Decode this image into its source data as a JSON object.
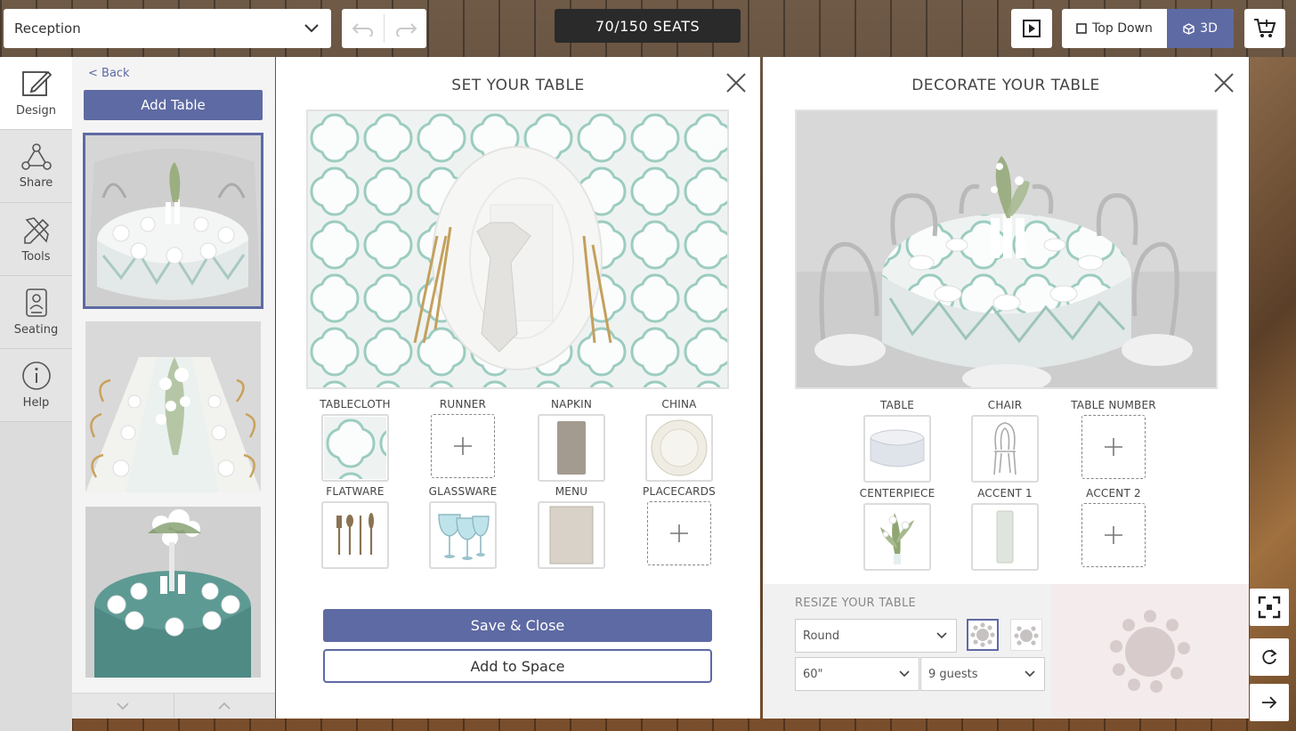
{
  "top_bar": {
    "venue_value": "Reception",
    "seats_text": "70/150 SEATS",
    "view_top_down": "Top Down",
    "view_3d": "3D",
    "active_view": "3D"
  },
  "left_nav": {
    "items": [
      {
        "label": "Design",
        "icon": "pencil-square-icon",
        "active": true
      },
      {
        "label": "Share",
        "icon": "share-nodes-icon",
        "active": false
      },
      {
        "label": "Tools",
        "icon": "tools-icon",
        "active": false
      },
      {
        "label": "Seating",
        "icon": "seating-chart-icon",
        "active": false
      },
      {
        "label": "Help",
        "icon": "info-circle-icon",
        "active": false
      }
    ]
  },
  "thumbs": {
    "back_label": "< Back",
    "add_table_label": "Add Table",
    "items": [
      {
        "kind": "round table with geometric cloth",
        "selected": true
      },
      {
        "kind": "long table with gold chairs",
        "selected": false
      },
      {
        "kind": "round table with teal cloth",
        "selected": false
      }
    ]
  },
  "set_table": {
    "title": "SET YOUR TABLE",
    "slots_row1": [
      {
        "label": "TABLECLOTH",
        "filled": true
      },
      {
        "label": "RUNNER",
        "filled": false
      },
      {
        "label": "NAPKIN",
        "filled": true
      },
      {
        "label": "CHINA",
        "filled": true
      }
    ],
    "slots_row2": [
      {
        "label": "FLATWARE",
        "filled": true
      },
      {
        "label": "GLASSWARE",
        "filled": true
      },
      {
        "label": "MENU",
        "filled": true
      },
      {
        "label": "PLACECARDS",
        "filled": false
      }
    ],
    "save_label": "Save & Close",
    "add_space_label": "Add to Space"
  },
  "decorate_table": {
    "title": "DECORATE YOUR TABLE",
    "slots_row1": [
      {
        "label": "TABLE",
        "filled": true
      },
      {
        "label": "CHAIR",
        "filled": true
      },
      {
        "label": "TABLE NUMBER",
        "filled": false
      }
    ],
    "slots_row2": [
      {
        "label": "CENTERPIECE",
        "filled": true
      },
      {
        "label": "ACCENT 1",
        "filled": true
      },
      {
        "label": "ACCENT 2",
        "filled": false
      }
    ],
    "resize": {
      "title": "RESIZE YOUR TABLE",
      "shape_value": "Round",
      "size_value": "60\"",
      "guests_value": "9 guests"
    }
  },
  "colors": {
    "accent": "#5e6aa3",
    "seat_badge": "#2a2a2a"
  }
}
